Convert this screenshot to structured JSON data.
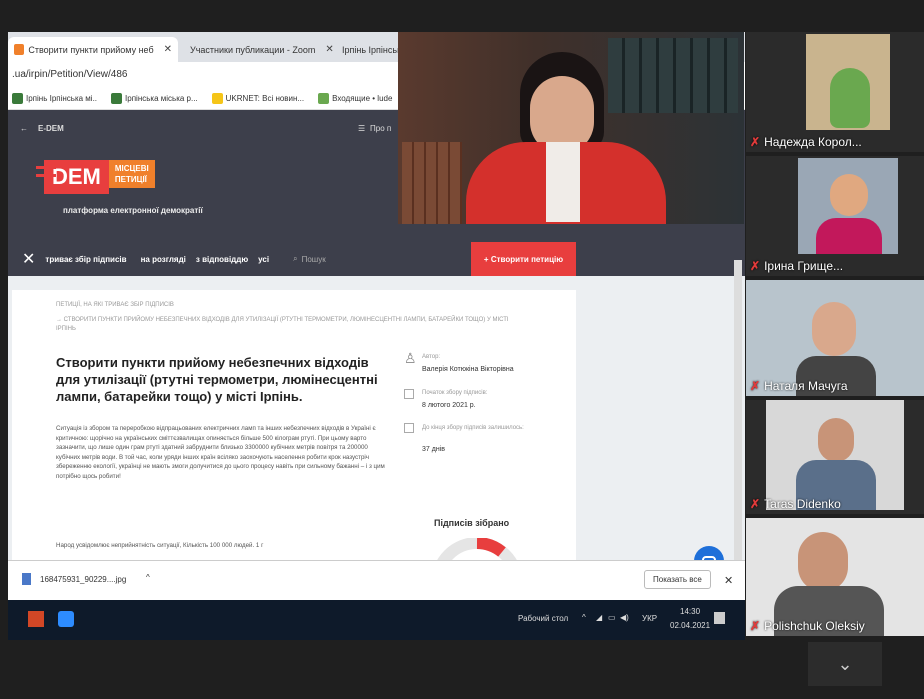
{
  "browser": {
    "tabs": [
      {
        "label": "Створити пункти прийому неб"
      },
      {
        "label": "Участники публикации - Zoom"
      },
      {
        "label": "Ірпінь Ірпінська"
      }
    ],
    "address": ".ua/irpin/Petition/View/486",
    "bookmarks": [
      "Ірпінь Ірпінська мі..",
      "Ірпінська міська р...",
      "UKRNET: Всі новин...",
      "Входящие • lude"
    ]
  },
  "site": {
    "nav_back": "E-DEM",
    "nav_right": "Про п",
    "logo_dem": "DEM",
    "logo_sub1": "МІСЦЕВІ",
    "logo_sub2": "ПЕТИЦІЇ",
    "tagline": "платформа електронної демократії",
    "filters": [
      "триває збір підписів",
      "на розгляді",
      "з відповіддю",
      "усі"
    ],
    "search_placeholder": "Пошук",
    "create_button": "+ Створити петицію",
    "breadcrumb1": "ПЕТИЦІЇ, НА ЯКІ ТРИВАЄ ЗБІР ПІДПИСІВ",
    "breadcrumb2": "→ СТВОРИТИ ПУНКТИ ПРИЙОМУ НЕБЕЗПЕЧНИХ ВІДХОДІВ ДЛЯ УТИЛІЗАЦІЇ (РТУТНІ ТЕРМОМЕТРИ, ЛЮМІНЕСЦЕНТНІ ЛАМПИ, БАТАРЕЙКИ ТОЩО) У МІСТІ ІРПІНЬ",
    "petition_title": "Створити пункти прийому небезпечних відходів для утилізації (ртутні термометри, люмінесцентні лампи, батарейки тощо) у місті Ірпінь.",
    "petition_body": "Ситуація із збором та переробкою відпрацьованих електричних ламп та інших небезпечних відходів в Україні є критичною: щорічно на українських сміттєзвалищах опиняється більше 500 кілограм ртуті. При цьому варто зазначити, що лише один грам ртуті здатний забруднити близько 3300000 кубічних метрів повітря та 200000 кубічних метрів води. В той час, коли уряди інших країн всіляко заохочують населення робити крок назустріч збереженню екології, українці не мають змоги долучитися до цього процесу навіть при сильному бажанні – і з цим потрібно щось робити!",
    "petition_body2": "Народ усвідомлює неприйнятність ситуації, Кількість 100 000 людей. 1 г",
    "author_label": "Автор:",
    "author_name": "Валерія Котюкіна Вікторівна",
    "start_label": "Початок збору підписів:",
    "start_date": "8 лютого 2021 р.",
    "end_label": "До кінця збору підписів залишилось:",
    "end_value": "37 днів",
    "signatures_label": "Підписів зібрано"
  },
  "download": {
    "file": "168475931_90229....jpg",
    "show_all": "Показать все"
  },
  "taskbar": {
    "desktop": "Рабочий стол",
    "lang": "УКР",
    "time": "14:30",
    "date": "02.04.2021"
  },
  "participants": [
    {
      "name": "Надежда Корол..."
    },
    {
      "name": "Ірина Грище..."
    },
    {
      "name": "Наталя Мачуга"
    },
    {
      "name": "Taras Didenko"
    },
    {
      "name": "Polishchuk Oleksiy"
    }
  ],
  "colors": {
    "accent": "#e83e3e",
    "orange": "#f0802b",
    "dark": "#3d3f4b",
    "chat": "#1e6fd9"
  }
}
